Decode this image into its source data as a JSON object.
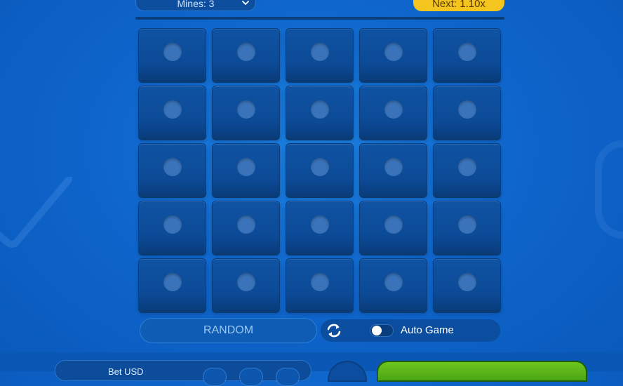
{
  "header": {
    "mines_select_label": "Mines: 3",
    "next_multiplier_label": "Next: 1.10x"
  },
  "grid": {
    "rows": 5,
    "cols": 5,
    "tile_state": "hidden"
  },
  "controls": {
    "random_label": "RANDOM",
    "auto_game_label": "Auto Game",
    "auto_game_enabled": false
  },
  "bet_panel": {
    "label": "Bet USD"
  },
  "colors": {
    "accent_yellow": "#f4c51e",
    "tile_blue": "#0f53a3",
    "bet_green": "#6ec51e",
    "background_blue": "#0f66cc"
  },
  "icons": {
    "mines_dropdown": "chevron-down-icon",
    "refresh": "refresh-icon",
    "tile_dot": "circle-dot-icon"
  }
}
